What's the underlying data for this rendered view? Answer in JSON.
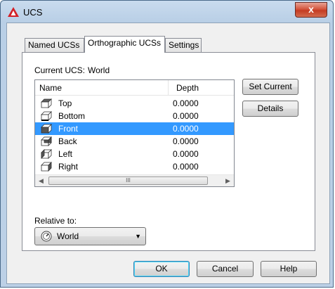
{
  "window": {
    "title": "UCS",
    "close_glyph": "x"
  },
  "tabs": [
    {
      "label": "Named UCSs"
    },
    {
      "label": "Orthographic UCSs"
    },
    {
      "label": "Settings"
    }
  ],
  "current_ucs": {
    "label": "Current UCS:",
    "value": "World"
  },
  "list": {
    "columns": {
      "name": "Name",
      "depth": "Depth"
    },
    "rows": [
      {
        "name": "Top",
        "depth": "0.0000",
        "icon": "cube-top-icon"
      },
      {
        "name": "Bottom",
        "depth": "0.0000",
        "icon": "cube-bottom-icon"
      },
      {
        "name": "Front",
        "depth": "0.0000",
        "icon": "cube-front-icon",
        "selected": true
      },
      {
        "name": "Back",
        "depth": "0.0000",
        "icon": "cube-back-icon"
      },
      {
        "name": "Left",
        "depth": "0.0000",
        "icon": "cube-left-icon"
      },
      {
        "name": "Right",
        "depth": "0.0000",
        "icon": "cube-right-icon"
      }
    ],
    "scroll_grip": "III"
  },
  "buttons": {
    "set_current": "Set Current",
    "details": "Details"
  },
  "relative_to": {
    "label": "Relative to:",
    "value": "World"
  },
  "footer": {
    "ok": "OK",
    "cancel": "Cancel",
    "help": "Help"
  },
  "colors": {
    "selection": "#3399ff",
    "close_button": "#c43b22"
  }
}
